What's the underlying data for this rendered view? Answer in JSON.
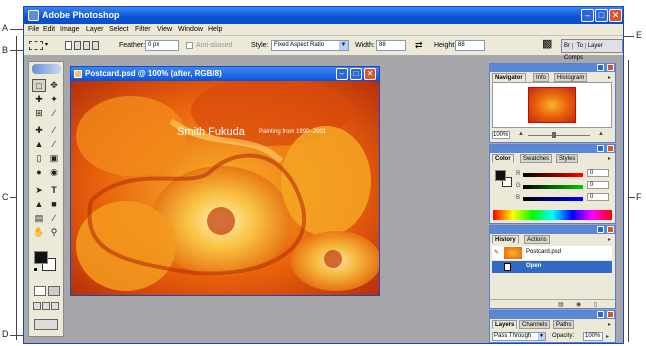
{
  "callouts": {
    "a": "A",
    "b": "B",
    "c": "C",
    "d": "D",
    "e": "E",
    "f": "F"
  },
  "app": {
    "title": "Adobe Photoshop"
  },
  "menu": [
    "File",
    "Edit",
    "Image",
    "Layer",
    "Select",
    "Filter",
    "View",
    "Window",
    "Help"
  ],
  "options": {
    "feather_label": "Feather:",
    "feather_value": "0 px",
    "antialias_label": "Anti-aliased",
    "style_label": "Style:",
    "style_value": "Fixed Aspect Ratio",
    "width_label": "Width:",
    "width_value": "88",
    "height_label": "Height:",
    "height_value": "88"
  },
  "palette_well": {
    "tab1": "Br",
    "tab2": "To",
    "tab3": "Layer Comps"
  },
  "document": {
    "title": "Postcard.psd @ 100% (after, RGB/8)",
    "art_name": "Smith Fukuda",
    "art_subtitle": "Painting from 1990–2001"
  },
  "navigator": {
    "tabs": [
      "Navigator",
      "Info",
      "Histogram"
    ],
    "zoom": "100%"
  },
  "color": {
    "tabs": [
      "Color",
      "Swatches",
      "Styles"
    ],
    "r_label": "R",
    "g_label": "G",
    "b_label": "B",
    "r": "0",
    "g": "0",
    "b": "0"
  },
  "history": {
    "tabs": [
      "History",
      "Actions"
    ],
    "snapshot": "Postcard.psd",
    "step": "Open"
  },
  "layers": {
    "tabs": [
      "Layers",
      "Channels",
      "Paths"
    ],
    "blend_mode": "Pass Through",
    "opacity_label": "Opacity:",
    "opacity_value": "100%"
  },
  "colors": {
    "titlebar": "#0a53d6",
    "workspace": "#a7a7ab",
    "ui": "#ece9d8",
    "selected": "#316ac5",
    "art_orange": "#e8600c"
  }
}
